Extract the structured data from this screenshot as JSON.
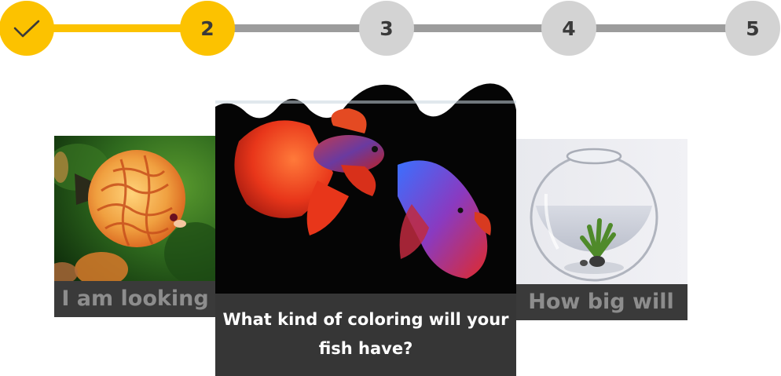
{
  "colors": {
    "accent": "#fcc200",
    "inactive": "#d3d3d3",
    "line_inactive": "#9c9c9c",
    "caption_bg": "#3a3a3a"
  },
  "stepper": {
    "steps": [
      {
        "label": "",
        "state": "completed",
        "icon": "check-icon"
      },
      {
        "label": "2",
        "state": "current"
      },
      {
        "label": "3",
        "state": "upcoming"
      },
      {
        "label": "4",
        "state": "upcoming"
      },
      {
        "label": "5",
        "state": "upcoming"
      }
    ]
  },
  "carousel": {
    "cards": [
      {
        "caption": "I am looking",
        "image": "discus-fish-photo",
        "position": "left"
      },
      {
        "caption": "What kind of coloring will your fish have?",
        "image": "betta-fish-photo",
        "position": "center"
      },
      {
        "caption": "How big will",
        "image": "fishbowl-photo",
        "position": "right"
      }
    ]
  }
}
